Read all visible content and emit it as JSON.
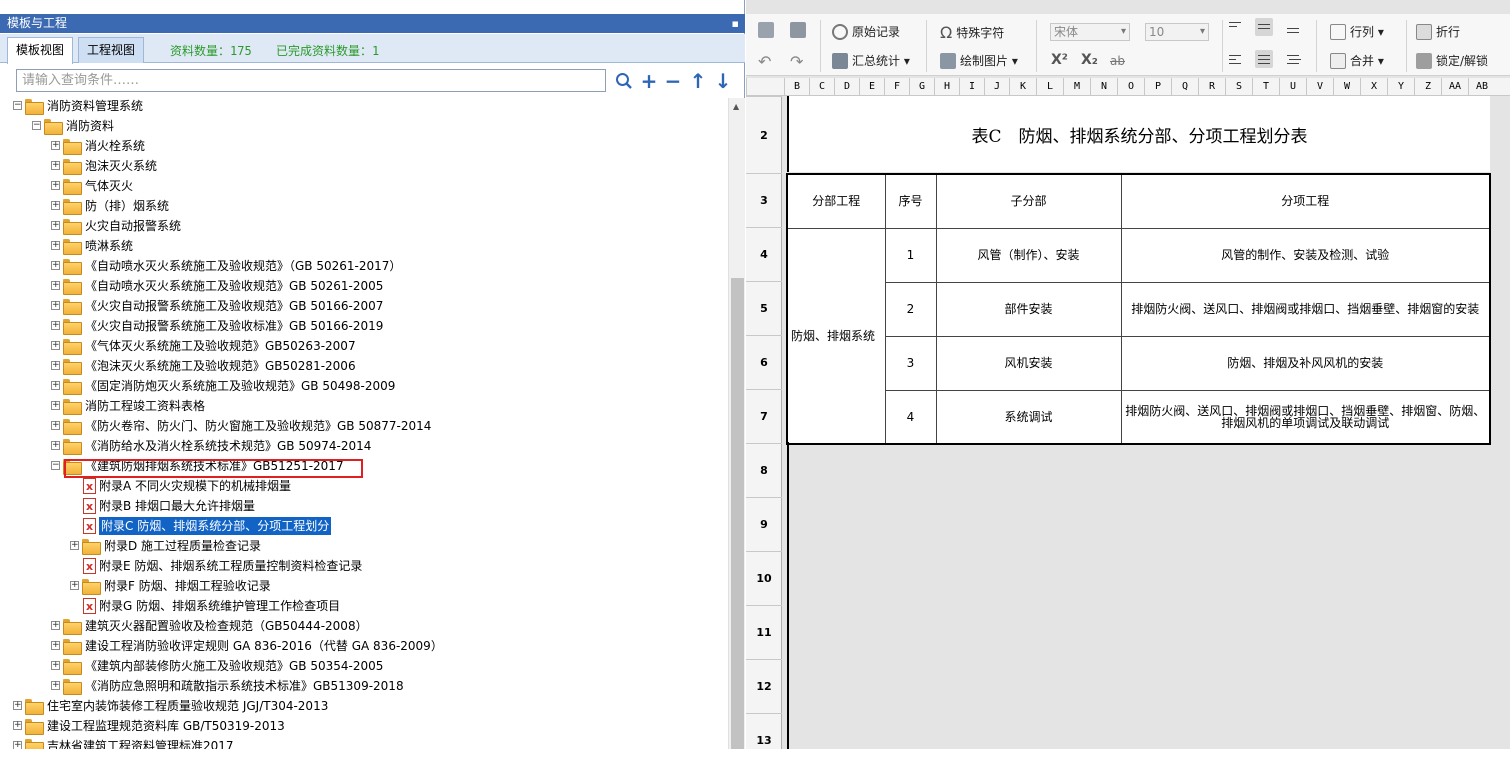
{
  "panel": {
    "title": "模板与工程",
    "pin": "📌",
    "tabs": [
      "模板视图",
      "工程视图"
    ],
    "count_label": "资料数量：175",
    "done_label": "已完成资料数量：1"
  },
  "search": {
    "placeholder": "请输入查询条件……"
  },
  "tree": [
    {
      "label": "消防资料管理系统",
      "level": 0,
      "type": "folder",
      "exp": "-"
    },
    {
      "label": "消防资料",
      "level": 1,
      "type": "folder",
      "exp": "-"
    },
    {
      "label": "消火栓系统",
      "level": 2,
      "type": "folder",
      "exp": "+"
    },
    {
      "label": "泡沫灭火系统",
      "level": 2,
      "type": "folder",
      "exp": "+"
    },
    {
      "label": "气体灭火",
      "level": 2,
      "type": "folder",
      "exp": "+"
    },
    {
      "label": "防（排）烟系统",
      "level": 2,
      "type": "folder",
      "exp": "+"
    },
    {
      "label": "火灾自动报警系统",
      "level": 2,
      "type": "folder",
      "exp": "+"
    },
    {
      "label": "喷淋系统",
      "level": 2,
      "type": "folder",
      "exp": "+"
    },
    {
      "label": "《自动喷水灭火系统施工及验收规范》（GB 50261-2017）",
      "level": 2,
      "type": "folder",
      "exp": "+"
    },
    {
      "label": "《自动喷水灭火系统施工及验收规范》GB 50261-2005",
      "level": 2,
      "type": "folder",
      "exp": "+"
    },
    {
      "label": "《火灾自动报警系统施工及验收规范》GB 50166-2007",
      "level": 2,
      "type": "folder",
      "exp": "+"
    },
    {
      "label": "《火灾自动报警系统施工及验收标准》GB 50166-2019",
      "level": 2,
      "type": "folder",
      "exp": "+"
    },
    {
      "label": "《气体灭火系统施工及验收规范》GB50263-2007",
      "level": 2,
      "type": "folder",
      "exp": "+"
    },
    {
      "label": "《泡沫灭火系统施工及验收规范》GB50281-2006",
      "level": 2,
      "type": "folder",
      "exp": "+"
    },
    {
      "label": "《固定消防炮灭火系统施工及验收规范》GB 50498-2009",
      "level": 2,
      "type": "folder",
      "exp": "+"
    },
    {
      "label": "消防工程竣工资料表格",
      "level": 2,
      "type": "folder",
      "exp": "+"
    },
    {
      "label": "《防火卷帘、防火门、防火窗施工及验收规范》GB 50877-2014",
      "level": 2,
      "type": "folder",
      "exp": "+"
    },
    {
      "label": "《消防给水及消火栓系统技术规范》GB 50974-2014",
      "level": 2,
      "type": "folder",
      "exp": "+"
    },
    {
      "label": "《建筑防烟排烟系统技术标准》GB51251-2017",
      "level": 2,
      "type": "folder",
      "exp": "-"
    },
    {
      "label": "附录A 不同火灾规模下的机械排烟量",
      "level": 3,
      "type": "doc",
      "exp": ""
    },
    {
      "label": "附录B 排烟口最大允许排烟量",
      "level": 3,
      "type": "doc",
      "exp": ""
    },
    {
      "label": "附录C 防烟、排烟系统分部、分项工程划分",
      "level": 3,
      "type": "doc",
      "exp": "",
      "selected": true
    },
    {
      "label": "附录D 施工过程质量检查记录",
      "level": 3,
      "type": "folder",
      "exp": "+"
    },
    {
      "label": "附录E 防烟、排烟系统工程质量控制资料检查记录",
      "level": 3,
      "type": "doc",
      "exp": ""
    },
    {
      "label": "附录F 防烟、排烟工程验收记录",
      "level": 3,
      "type": "folder",
      "exp": "+"
    },
    {
      "label": "附录G 防烟、排烟系统维护管理工作检查项目",
      "level": 3,
      "type": "doc",
      "exp": ""
    },
    {
      "label": "建筑灭火器配置验收及检查规范（GB50444-2008）",
      "level": 2,
      "type": "folder",
      "exp": "+"
    },
    {
      "label": "建设工程消防验收评定规则 GA 836-2016（代替 GA 836-2009）",
      "level": 2,
      "type": "folder",
      "exp": "+"
    },
    {
      "label": "《建筑内部装修防火施工及验收规范》GB 50354-2005",
      "level": 2,
      "type": "folder",
      "exp": "+"
    },
    {
      "label": "《消防应急照明和疏散指示系统技术标准》GB51309-2018",
      "level": 2,
      "type": "folder",
      "exp": "+"
    },
    {
      "label": "住宅室内装饰装修工程质量验收规范 JGJ/T304-2013",
      "level": 0,
      "type": "folder",
      "exp": "+"
    },
    {
      "label": "建设工程监理规范资料库 GB/T50319-2013",
      "level": 0,
      "type": "folder",
      "exp": "+"
    },
    {
      "label": "吉林省建筑工程资料管理标准2017",
      "level": 0,
      "type": "folder",
      "exp": "+"
    }
  ],
  "toolbar": {
    "original_record": "原始记录",
    "special_char": "特殊字符",
    "summary": "汇总统计 ▾",
    "draw_image": "绘制图片 ▾",
    "font_name": "宋体",
    "font_size": "10",
    "row_col": "行列 ▾",
    "merge": "合并 ▾",
    "wrap": "折行",
    "lock": "锁定/解锁",
    "superscript": "X²",
    "subscript": "X₂",
    "strike": "ab"
  },
  "columns": [
    "B",
    "C",
    "D",
    "E",
    "F",
    "G",
    "H",
    "I",
    "J",
    "K",
    "L",
    "M",
    "N",
    "O",
    "P",
    "Q",
    "R",
    "S",
    "T",
    "U",
    "V",
    "W",
    "X",
    "Y",
    "Z",
    "AA",
    "AB"
  ],
  "rows": [
    "2",
    "3",
    "4",
    "5",
    "6",
    "7",
    "8",
    "9",
    "10",
    "11",
    "12",
    "13"
  ],
  "sheet": {
    "title": "表C　防烟、排烟系统分部、分项工程划分表",
    "headers": [
      "分部工程",
      "序号",
      "子分部",
      "分项工程"
    ],
    "division": "防烟、排烟系统",
    "items": [
      {
        "no": "1",
        "sub": "风管（制作）、安装",
        "detail": "风管的制作、安装及检测、试验"
      },
      {
        "no": "2",
        "sub": "部件安装",
        "detail": "排烟防火阀、送风口、排烟阀或排烟口、挡烟垂壁、排烟窗的安装"
      },
      {
        "no": "3",
        "sub": "风机安装",
        "detail": "防烟、排烟及补风风机的安装"
      },
      {
        "no": "4",
        "sub": "系统调试",
        "detail": "排烟防火阀、送风口、排烟阀或排烟口、挡烟垂壁、排烟窗、防烟、排烟风机的单项调试及联动调试"
      }
    ]
  }
}
